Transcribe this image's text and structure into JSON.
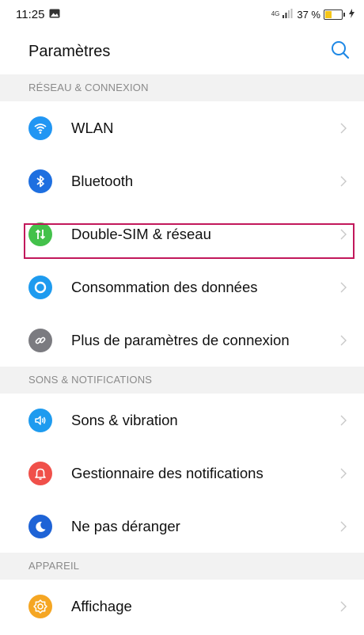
{
  "status_bar": {
    "time": "11:25",
    "network": "4G",
    "battery": "37 %",
    "battery_level": 0.37,
    "icons": [
      "gallery-notification-icon",
      "signal-icon",
      "battery-icon",
      "charging-icon"
    ]
  },
  "header": {
    "title": "Paramètres",
    "search_icon": "search-icon",
    "accent_color": "#1e88e5"
  },
  "sections": [
    {
      "title": "RÉSEAU & CONNEXION",
      "items": [
        {
          "label": "WLAN",
          "icon": "wifi-icon",
          "color": "#2196f3"
        },
        {
          "label": "Bluetooth",
          "icon": "bluetooth-icon",
          "color": "#1e6fe0"
        },
        {
          "label": "Double-SIM & réseau",
          "icon": "dual-sim-icon",
          "color": "#43c14b"
        },
        {
          "label": "Consommation des données",
          "icon": "data-usage-icon",
          "color": "#1e9bef"
        },
        {
          "label": "Plus de paramètres de connexion",
          "icon": "link-icon",
          "color": "#7b7b80"
        }
      ]
    },
    {
      "title": "SONS & NOTIFICATIONS",
      "items": [
        {
          "label": "Sons & vibration",
          "icon": "sound-icon",
          "color": "#1e9bef"
        },
        {
          "label": "Gestionnaire des notifications",
          "icon": "bell-icon",
          "color": "#f0504a"
        },
        {
          "label": "Ne pas déranger",
          "icon": "moon-icon",
          "color": "#1e63d6"
        }
      ]
    },
    {
      "title": "APPAREIL",
      "items": [
        {
          "label": "Affichage",
          "icon": "display-icon",
          "color": "#f5a623"
        }
      ]
    }
  ],
  "highlight_color": "#c2185b"
}
